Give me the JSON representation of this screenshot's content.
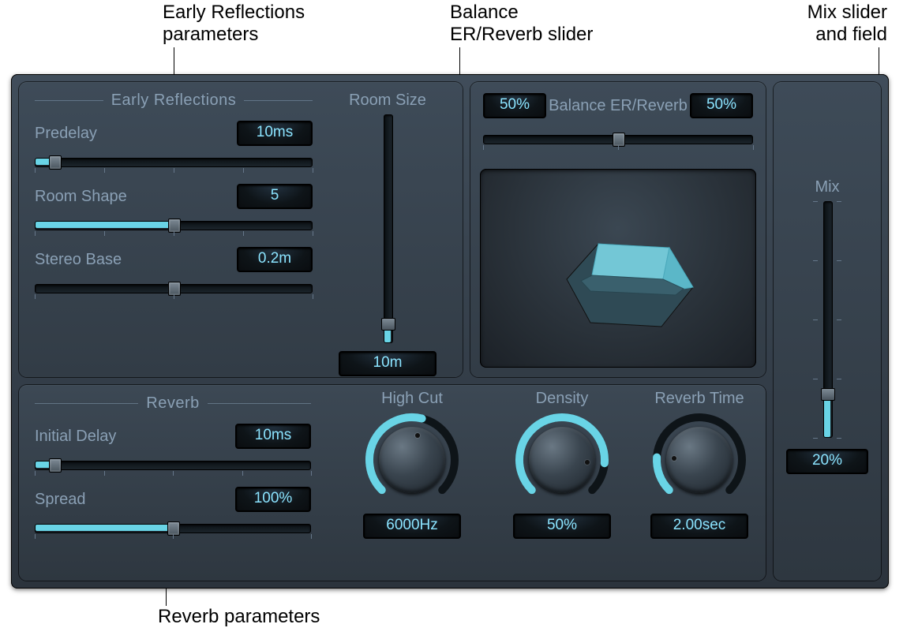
{
  "callouts": {
    "er_params": "Early Reflections\nparameters",
    "balance": "Balance\nER/Reverb slider",
    "mix": "Mix slider\nand field",
    "reverb_params": "Reverb parameters"
  },
  "sections": {
    "early_reflections": "Early Reflections",
    "reverb": "Reverb"
  },
  "er": {
    "predelay": {
      "label": "Predelay",
      "value": "10ms",
      "fill_pct": 7
    },
    "room_shape": {
      "label": "Room Shape",
      "value": "5",
      "fill_pct": 50
    },
    "stereo_base": {
      "label": "Stereo Base",
      "value": "0.2m",
      "thumb_pct": 50
    }
  },
  "room_size": {
    "label": "Room Size",
    "value": "10m",
    "fill_pct": 8
  },
  "balance": {
    "label": "Balance ER/Reverb",
    "left_value": "50%",
    "right_value": "50%",
    "thumb_pct": 50
  },
  "reverb": {
    "initial_delay": {
      "label": "Initial Delay",
      "value": "10ms",
      "fill_pct": 7
    },
    "spread": {
      "label": "Spread",
      "value": "100%",
      "fill_pct": 50
    }
  },
  "knobs": {
    "high_cut": {
      "label": "High Cut",
      "value": "6000Hz",
      "angle_pct": 55
    },
    "density": {
      "label": "Density",
      "value": "50%",
      "angle_pct": 85
    },
    "reverb_time": {
      "label": "Reverb Time",
      "value": "2.00sec",
      "angle_pct": 18
    }
  },
  "mix": {
    "label": "Mix",
    "value": "20%",
    "fill_pct": 18
  }
}
